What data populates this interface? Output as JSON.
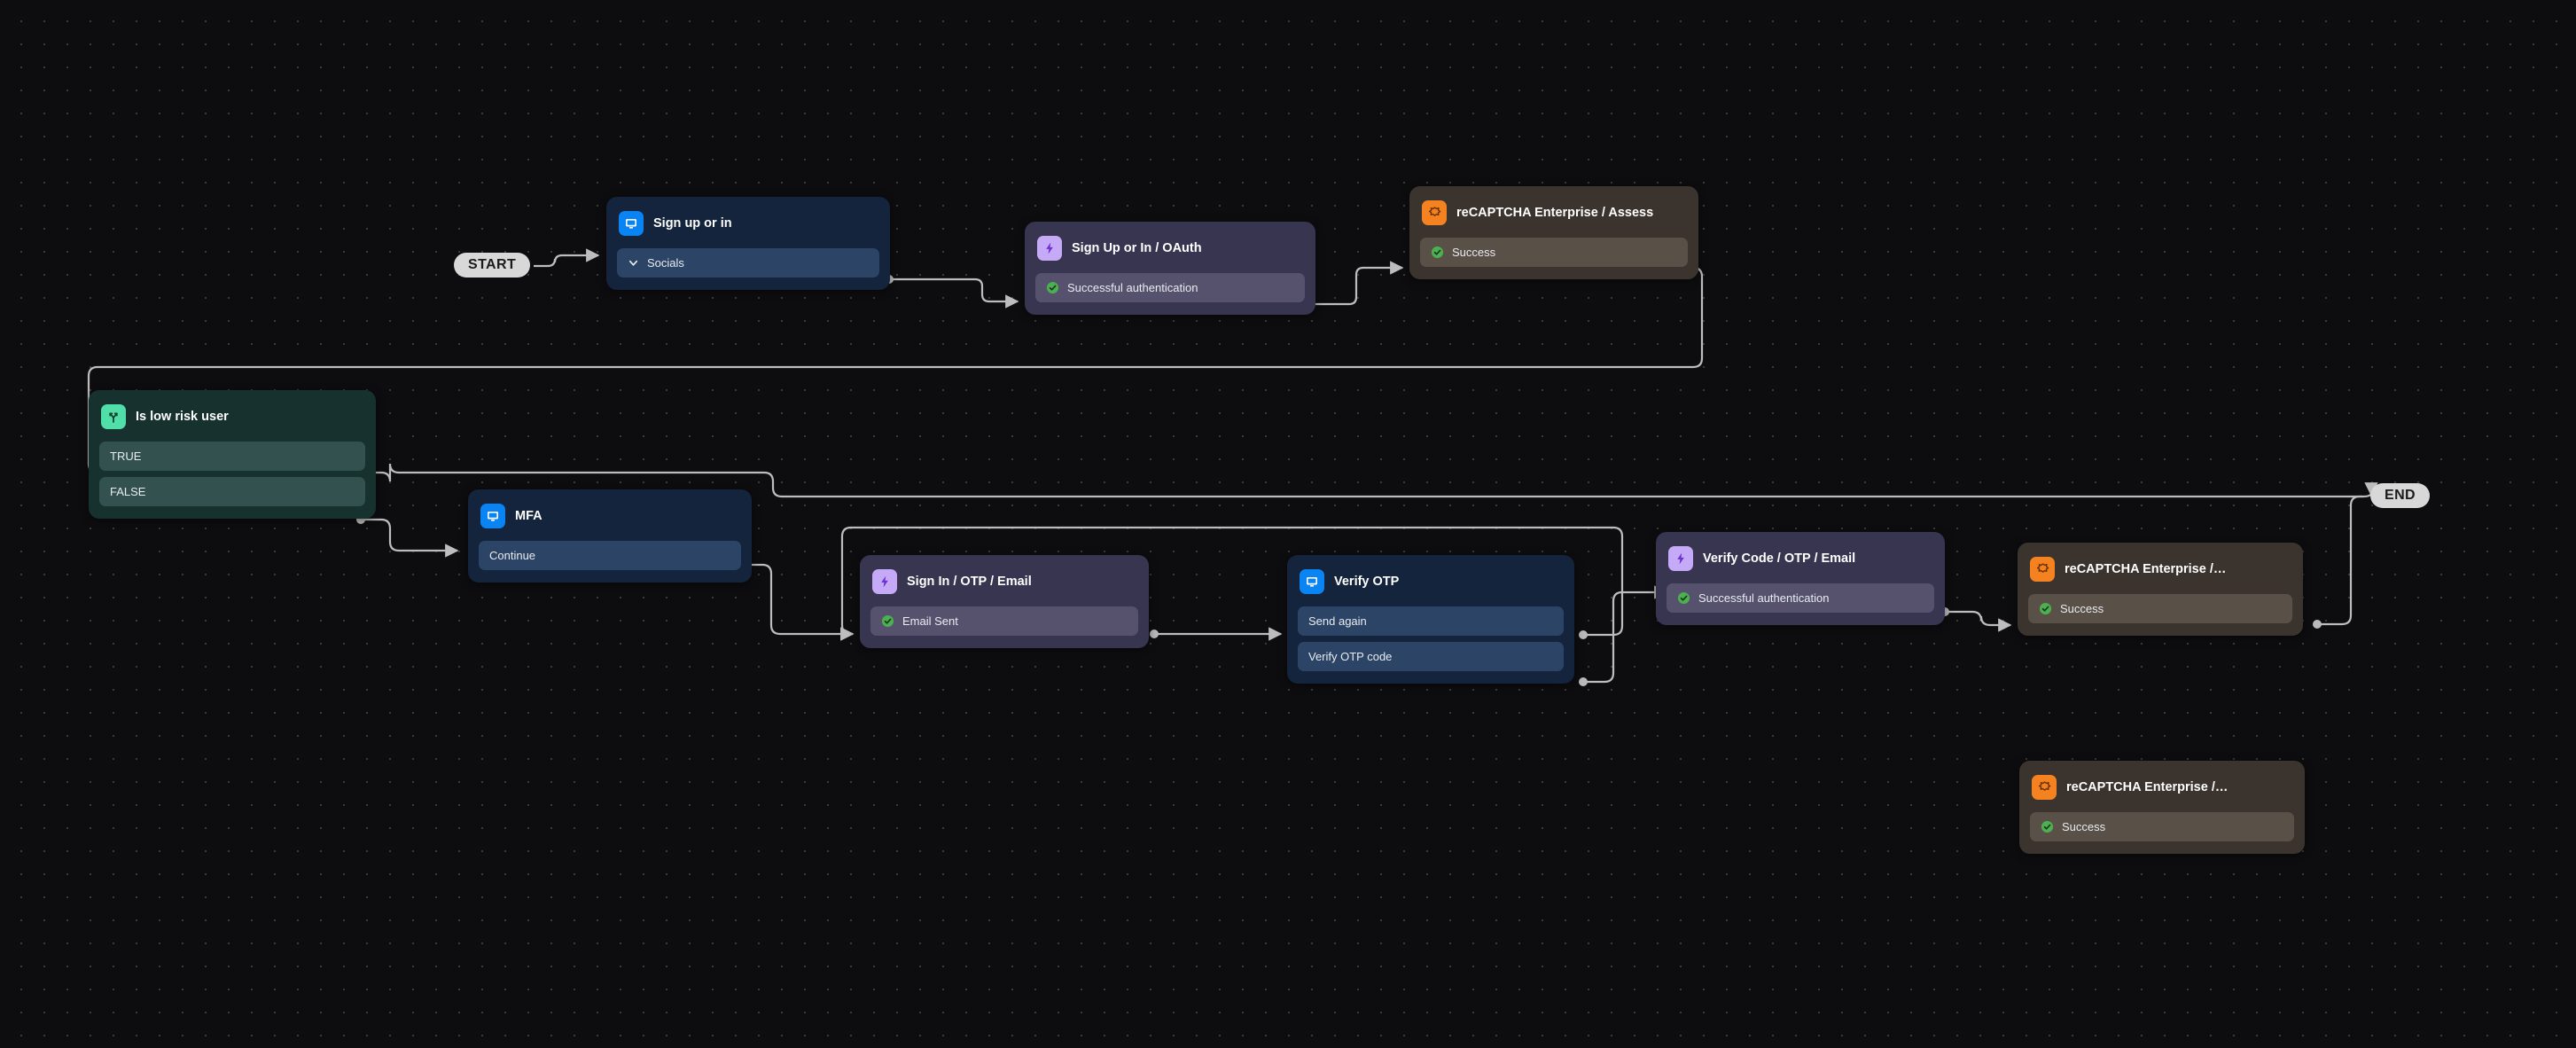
{
  "canvas": {
    "background_color": "#0d0d0f",
    "grid_dot_color": "#3a3a3c",
    "edge_color": "#bdbdbd"
  },
  "terminals": {
    "start_label": "START",
    "end_label": "END"
  },
  "palette": {
    "screen_node_bg": "#13243c",
    "screen_row_bg": "#2c4465",
    "screen_icon_bg": "#0b84f3",
    "action_node_bg": "#383550",
    "action_row_bg": "#56526e",
    "action_icon_bg": "#c5aaf7",
    "captcha_node_bg": "#3b342e",
    "captcha_row_bg": "#595047",
    "captcha_icon_bg": "#f58220",
    "branch_node_bg": "#17312f",
    "branch_row_bg": "#33514e",
    "branch_icon_bg": "#50dfa9",
    "success_green": "#4caf50",
    "pill_bg": "#d8d8d8"
  },
  "nodes": [
    {
      "id": "sign-up-or-in",
      "title": "Sign up or in",
      "type": "screen",
      "icon": "screen-icon",
      "rows": [
        {
          "label": "Socials",
          "marker": "chevron-down-icon"
        }
      ]
    },
    {
      "id": "sign-up-or-in-oauth",
      "title": "Sign Up or In / OAuth",
      "type": "action",
      "icon": "lightning-bolt-icon",
      "rows": [
        {
          "label": "Successful authentication",
          "marker": "success-check-icon"
        }
      ]
    },
    {
      "id": "recaptcha-enterprise-assess",
      "title": "reCAPTCHA Enterprise / Assess",
      "type": "captcha",
      "icon": "recaptcha-icon",
      "rows": [
        {
          "label": "Success",
          "marker": "success-check-icon"
        }
      ]
    },
    {
      "id": "is-low-risk-user",
      "title": "Is low risk user",
      "type": "branch",
      "icon": "branch-fork-icon",
      "rows": [
        {
          "label": "TRUE",
          "marker": "none"
        },
        {
          "label": "FALSE",
          "marker": "none"
        }
      ]
    },
    {
      "id": "mfa",
      "title": "MFA",
      "type": "screen",
      "icon": "screen-icon",
      "rows": [
        {
          "label": "Continue",
          "marker": "none"
        }
      ]
    },
    {
      "id": "sign-in-otp-email",
      "title": "Sign In / OTP / Email",
      "type": "action",
      "icon": "lightning-bolt-icon",
      "rows": [
        {
          "label": "Email Sent",
          "marker": "success-check-icon"
        }
      ]
    },
    {
      "id": "verify-otp",
      "title": "Verify OTP",
      "type": "screen",
      "icon": "screen-icon",
      "rows": [
        {
          "label": "Send again",
          "marker": "none"
        },
        {
          "label": "Verify OTP code",
          "marker": "none"
        }
      ]
    },
    {
      "id": "verify-code-otp-email",
      "title": "Verify Code / OTP / Email",
      "type": "action",
      "icon": "lightning-bolt-icon",
      "rows": [
        {
          "label": "Successful authentication",
          "marker": "success-check-icon"
        }
      ]
    },
    {
      "id": "recaptcha-enterprise-2",
      "title": "reCAPTCHA Enterprise /…",
      "type": "captcha",
      "icon": "recaptcha-icon",
      "rows": [
        {
          "label": "Success",
          "marker": "success-check-icon"
        }
      ]
    },
    {
      "id": "recaptcha-enterprise-3",
      "title": "reCAPTCHA Enterprise /…",
      "type": "captcha",
      "icon": "recaptcha-icon",
      "rows": [
        {
          "label": "Success",
          "marker": "success-check-icon"
        }
      ]
    }
  ]
}
